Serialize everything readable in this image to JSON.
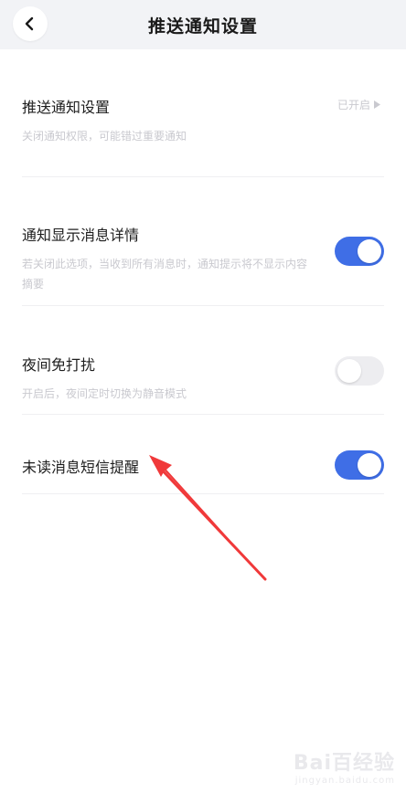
{
  "header": {
    "title": "推送通知设置",
    "back_icon": "chevron-left-icon"
  },
  "items": [
    {
      "title": "推送通知设置",
      "desc": "关闭通知权限，可能错过重要通知",
      "status": "已开启"
    },
    {
      "title": "通知显示消息详情",
      "desc": "若关闭此选项，当收到所有消息时，通知提示将不显示内容摘要",
      "toggle": true
    },
    {
      "title": "夜间免打扰",
      "desc": "开启后，夜间定时切换为静音模式",
      "toggle": false
    },
    {
      "title": "未读消息短信提醒",
      "toggle": true
    }
  ],
  "colors": {
    "accent": "#3f6ee6",
    "annotation_arrow": "#f0393a"
  },
  "watermark": {
    "text": "Bai百经验",
    "sub": "jingyan.baidu.com"
  }
}
